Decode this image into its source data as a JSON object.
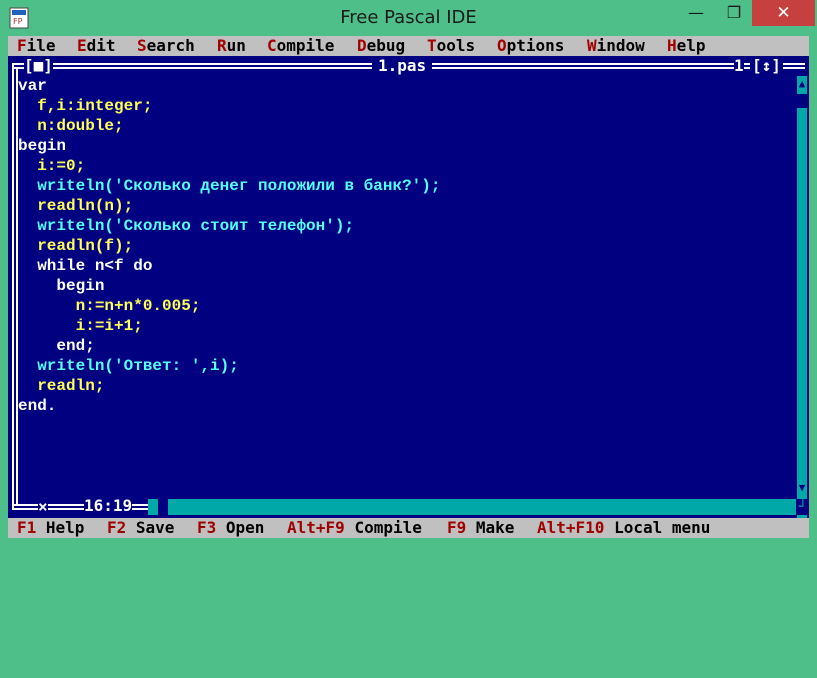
{
  "window": {
    "title": "Free Pascal IDE",
    "minimize": "—",
    "maximize": "❐",
    "close": "✕"
  },
  "menu": [
    {
      "hot": "F",
      "rest": "ile"
    },
    {
      "hot": "E",
      "rest": "dit"
    },
    {
      "hot": "S",
      "rest": "earch"
    },
    {
      "hot": "R",
      "rest": "un"
    },
    {
      "hot": "C",
      "rest": "ompile"
    },
    {
      "hot": "D",
      "rest": "ebug"
    },
    {
      "hot": "T",
      "rest": "ools"
    },
    {
      "hot": "O",
      "rest": "ptions"
    },
    {
      "hot": "W",
      "rest": "indow"
    },
    {
      "hot": "H",
      "rest": "elp"
    }
  ],
  "editor": {
    "close_box": "[■]",
    "filename": "1.pas",
    "window_number": "1",
    "zoom_box": "[↕]",
    "cursor_pos": "16:19",
    "modified_marker": "×"
  },
  "code": [
    "var",
    "  f,i:integer;",
    "  n:double;",
    "begin",
    "  i:=0;",
    "  writeln('Сколько денег положили в банк?');",
    "  readln(n);",
    "  writeln('Сколько стоит телефон');",
    "  readln(f);",
    "  while n<f do",
    "    begin",
    "      n:=n+n*0.005;",
    "      i:=i+1;",
    "    end;",
    "  writeln('Ответ: ',i);",
    "  readln;",
    "end."
  ],
  "status": [
    {
      "key": "F1",
      "label": "Help"
    },
    {
      "key": "F2",
      "label": "Save"
    },
    {
      "key": "F3",
      "label": "Open"
    },
    {
      "key": "Alt+F9",
      "label": "Compile"
    },
    {
      "key": "F9",
      "label": "Make"
    },
    {
      "key": "Alt+F10",
      "label": "Local menu"
    }
  ],
  "colors": {
    "desktop": "#4fbf8a",
    "editor_bg": "#000080",
    "identifier": "#ffff54",
    "string": "#54ffff",
    "number": "#00a8a8",
    "keyword": "#ffffff",
    "hotkey": "#a00000"
  }
}
